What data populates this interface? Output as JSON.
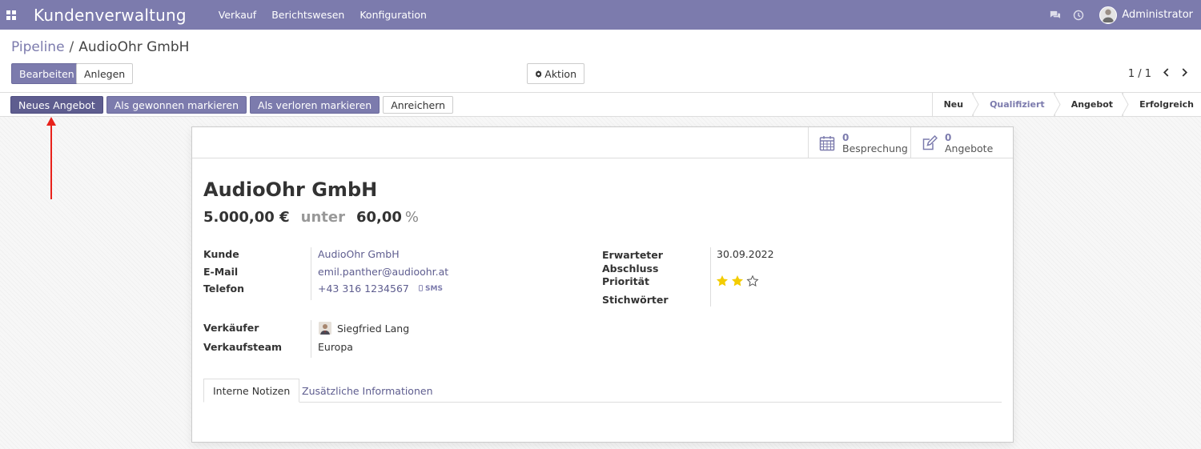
{
  "navbar": {
    "app_title": "Kundenverwaltung",
    "menu": [
      "Verkauf",
      "Berichtswesen",
      "Konfiguration"
    ],
    "user_name": "Administrator",
    "icons": [
      "apps-icon",
      "chat-icon",
      "clock-icon"
    ]
  },
  "breadcrumb": {
    "parent": "Pipeline",
    "separator": "/",
    "current": "AudioOhr GmbH"
  },
  "controls": {
    "edit_label": "Bearbeiten",
    "create_label": "Anlegen",
    "action_label": "Aktion",
    "pager_value": "1 / 1"
  },
  "statusbar": {
    "buttons": [
      "Neues Angebot",
      "Als gewonnen markieren",
      "Als verloren markieren",
      "Anreichern"
    ],
    "stages": [
      "Neu",
      "Qualifiziert",
      "Angebot",
      "Erfolgreich"
    ],
    "active_stage": "Qualifiziert"
  },
  "smart_buttons": {
    "meeting": {
      "count": "0",
      "label": "Besprechung"
    },
    "quotations": {
      "count": "0",
      "label": "Angebote"
    }
  },
  "lead": {
    "name": "AudioOhr GmbH",
    "expected_revenue": "5.000,00 €",
    "at_label": "unter",
    "probability": "60,00",
    "probability_unit": "%"
  },
  "fields": {
    "customer_label": "Kunde",
    "customer_value": "AudioOhr GmbH",
    "email_label": "E-Mail",
    "email_value": "emil.panther@audioohr.at",
    "phone_label": "Telefon",
    "phone_value": "+43 316 1234567",
    "sms_label": "SMS",
    "closing_label_line1": "Erwarteter",
    "closing_label_line2": "Abschluss",
    "closing_value": "30.09.2022",
    "priority_label": "Priorität",
    "priority_stars": 2,
    "priority_max": 3,
    "tags_label": "Stichwörter",
    "salesperson_label": "Verkäufer",
    "salesperson_value": "Siegfried Lang",
    "team_label": "Verkaufsteam",
    "team_value": "Europa"
  },
  "tabs": [
    "Interne Notizen",
    "Zusätzliche Informationen"
  ],
  "colors": {
    "brand": "#7c7bad",
    "brand_dark": "#5e5d8f",
    "star": "#f3cc00",
    "annotation": "#e8221b"
  }
}
